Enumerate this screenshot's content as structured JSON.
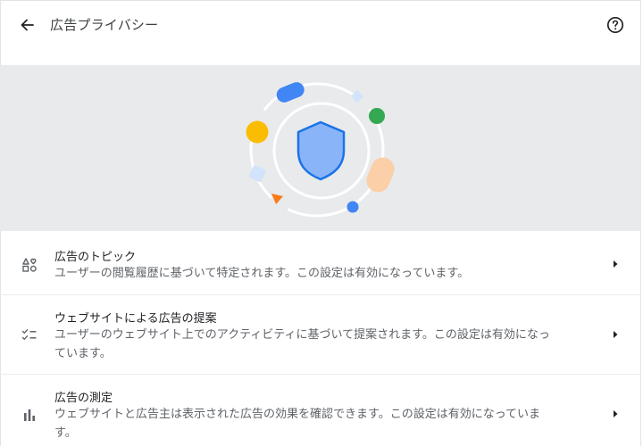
{
  "header": {
    "title": "広告プライバシー",
    "back_icon": "arrow-back-icon",
    "help_icon": "help-circle-icon"
  },
  "colors": {
    "banner_bg": "#e9eaeb",
    "shield_fill": "#8ab4f8",
    "shield_stroke": "#1a73e8",
    "blue": "#4285f4",
    "green": "#34a853",
    "yellow": "#fbbc04",
    "peach": "#fbcfa8",
    "orange": "#fa7b17"
  },
  "settings": [
    {
      "icon": "ad-topics-icon",
      "title": "広告のトピック",
      "description": "ユーザーの閲覧履歴に基づいて特定されます。この設定は有効になっています。"
    },
    {
      "icon": "site-suggested-ads-icon",
      "title": "ウェブサイトによる広告の提案",
      "description_line1": "ユーザーのウェブサイト上でのアクティビティに基づいて提案されます。この設定は有効になっ",
      "description_line2": "ています。"
    },
    {
      "icon": "bar-chart-icon",
      "title": "広告の測定",
      "description_line1": "ウェブサイトと広告主は表示された広告の効果を確認できます。この設定は有効になっていま",
      "description_line2": "す。"
    }
  ]
}
